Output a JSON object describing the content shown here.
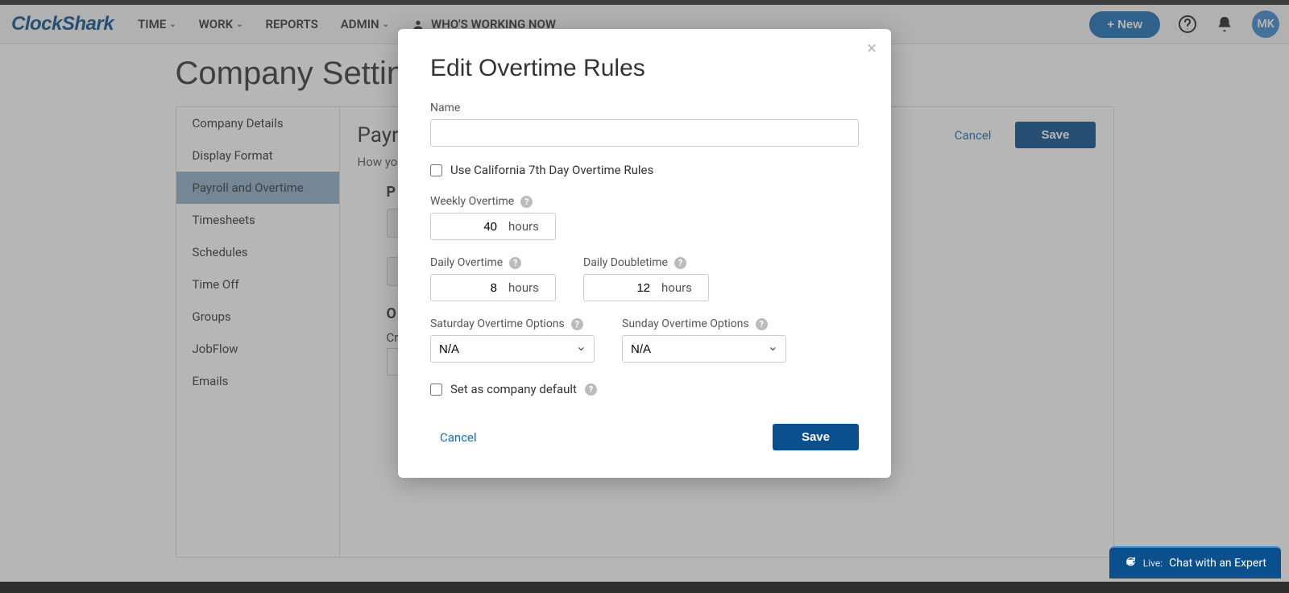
{
  "header": {
    "logo": "ClockShark",
    "nav": {
      "time": "TIME",
      "work": "WORK",
      "reports": "REPORTS",
      "admin": "ADMIN",
      "whos_working": "WHO'S WORKING NOW"
    },
    "new_button": "+ New",
    "avatar_initials": "MK"
  },
  "page": {
    "title": "Company Settings",
    "sidebar": {
      "item_0": "Company Details",
      "item_1": "Display Format",
      "item_2": "Payroll and Overtime",
      "item_3": "Timesheets",
      "item_4": "Schedules",
      "item_5": "Time Off",
      "item_6": "Groups",
      "item_7": "JobFlow",
      "item_8": "Emails"
    },
    "panel": {
      "title_visible": "Payr",
      "subtitle_visible": "How yo",
      "section_p": "P",
      "section_o": "O",
      "cr_label": "Cr",
      "cancel": "Cancel",
      "save": "Save"
    }
  },
  "modal": {
    "title": "Edit Overtime Rules",
    "name_label": "Name",
    "name_value": "",
    "california_label": "Use California 7th Day Overtime Rules",
    "weekly_label": "Weekly Overtime",
    "weekly_value": "40",
    "hours_unit": "hours",
    "daily_label": "Daily Overtime",
    "daily_value": "8",
    "doubletime_label": "Daily Doubletime",
    "doubletime_value": "12",
    "saturday_label": "Saturday Overtime Options",
    "saturday_value": "N/A",
    "sunday_label": "Sunday Overtime Options",
    "sunday_value": "N/A",
    "default_label": "Set as company default",
    "cancel": "Cancel",
    "save": "Save"
  },
  "chat": {
    "label": "Chat with an Expert",
    "prefix": "Live:"
  }
}
